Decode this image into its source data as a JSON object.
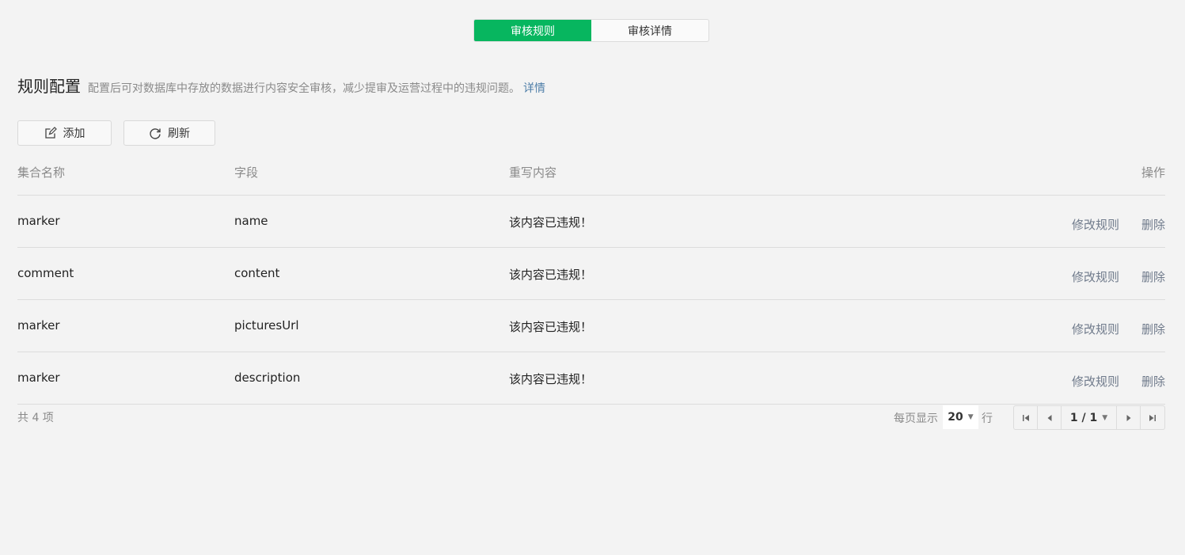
{
  "tabs": [
    {
      "label": "审核规则",
      "active": true
    },
    {
      "label": "审核详情",
      "active": false
    }
  ],
  "section": {
    "title": "规则配置",
    "description": "配置后可对数据库中存放的数据进行内容安全审核，减少提审及运营过程中的违规问题。",
    "link": "详情"
  },
  "toolbar": {
    "add_label": "添加",
    "refresh_label": "刷新"
  },
  "table": {
    "headers": [
      "集合名称",
      "字段",
      "重写内容",
      "操作"
    ],
    "rows": [
      {
        "collection": "marker",
        "field": "name",
        "rewrite": "该内容已违规！"
      },
      {
        "collection": "comment",
        "field": "content",
        "rewrite": "该内容已违规！"
      },
      {
        "collection": "marker",
        "field": "picturesUrl",
        "rewrite": "该内容已违规！"
      },
      {
        "collection": "marker",
        "field": "description",
        "rewrite": "该内容已违规！"
      }
    ],
    "actions": {
      "edit": "修改规则",
      "delete": "删除"
    }
  },
  "footer": {
    "total": "共 4 项",
    "per_page_label": "每页显示",
    "page_size": "20",
    "rows_unit": "行",
    "page_info": "1 / 1"
  },
  "colors": {
    "accent": "#07b65f",
    "link": "#4e7ea8"
  }
}
